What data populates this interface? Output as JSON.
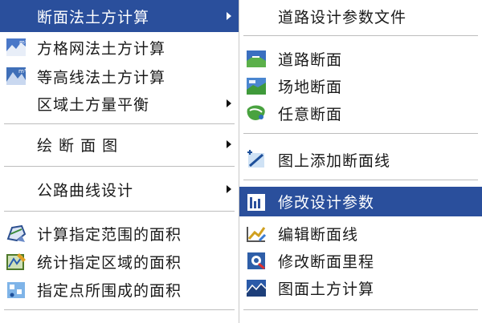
{
  "left_menu": {
    "items": [
      {
        "label": "断面法土方计算",
        "selected": true,
        "submenu": true,
        "icon": "none"
      },
      {
        "label": "方格网法土方计算",
        "icon": "grid-earthwork-icon"
      },
      {
        "label": "等高线法土方计算",
        "icon": "contour-earthwork-icon"
      },
      {
        "label": "区域土方量平衡",
        "submenu": true,
        "icon": "none"
      },
      {
        "label": "绘 断 面 图",
        "submenu": true,
        "icon": "none"
      },
      {
        "label": "公路曲线设计",
        "submenu": true,
        "icon": "none"
      },
      {
        "label": "计算指定范围的面积",
        "icon": "area-range-icon"
      },
      {
        "label": "统计指定区域的面积",
        "icon": "area-statistics-icon"
      },
      {
        "label": "指定点所围成的面积",
        "icon": "point-area-icon"
      }
    ]
  },
  "right_menu": {
    "items": [
      {
        "label": "道路设计参数文件",
        "icon": "none"
      },
      {
        "label": "道路断面",
        "icon": "road-section-icon"
      },
      {
        "label": "场地断面",
        "icon": "site-section-icon"
      },
      {
        "label": "任意断面",
        "icon": "arbitrary-section-icon"
      },
      {
        "label": "图上添加断面线",
        "icon": "add-section-line-icon"
      },
      {
        "label": "修改设计参数",
        "selected": true,
        "icon": "edit-params-icon"
      },
      {
        "label": "编辑断面线",
        "icon": "edit-section-line-icon"
      },
      {
        "label": "修改断面里程",
        "icon": "edit-mileage-icon"
      },
      {
        "label": "图面土方计算",
        "icon": "drawing-earthwork-icon"
      }
    ]
  },
  "colors": {
    "selection": "#2a4f9c",
    "menu_bg": "#ffffff"
  }
}
